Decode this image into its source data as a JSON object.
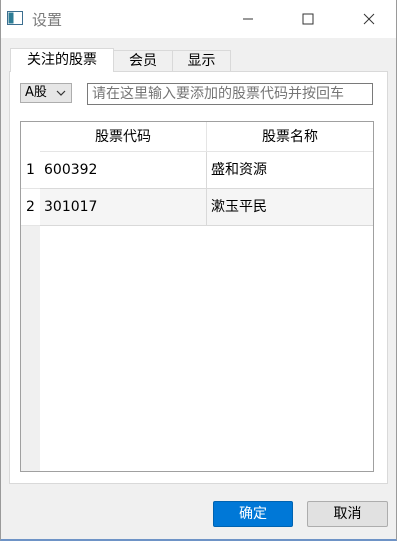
{
  "window": {
    "title": "设置",
    "icon": "app-window-icon",
    "controls": [
      "minimize-icon",
      "maximize-icon",
      "close-icon"
    ]
  },
  "tabs": [
    {
      "label": "关注的股票",
      "active": true
    },
    {
      "label": "会员",
      "active": false
    },
    {
      "label": "显示",
      "active": false
    }
  ],
  "filter": {
    "market_select": "A股",
    "code_input_placeholder": "请在这里输入要添加的股票代码并按回车"
  },
  "table": {
    "columns": [
      "股票代码",
      "股票名称"
    ],
    "rows": [
      {
        "num": "1",
        "code": "600392",
        "name": "盛和资源"
      },
      {
        "num": "2",
        "code": "301017",
        "name": "漱玉平民"
      }
    ]
  },
  "buttons": {
    "ok": "确定",
    "cancel": "取消"
  },
  "colors": {
    "accent": "#0078d7",
    "title_text": "#7a7a7a"
  }
}
